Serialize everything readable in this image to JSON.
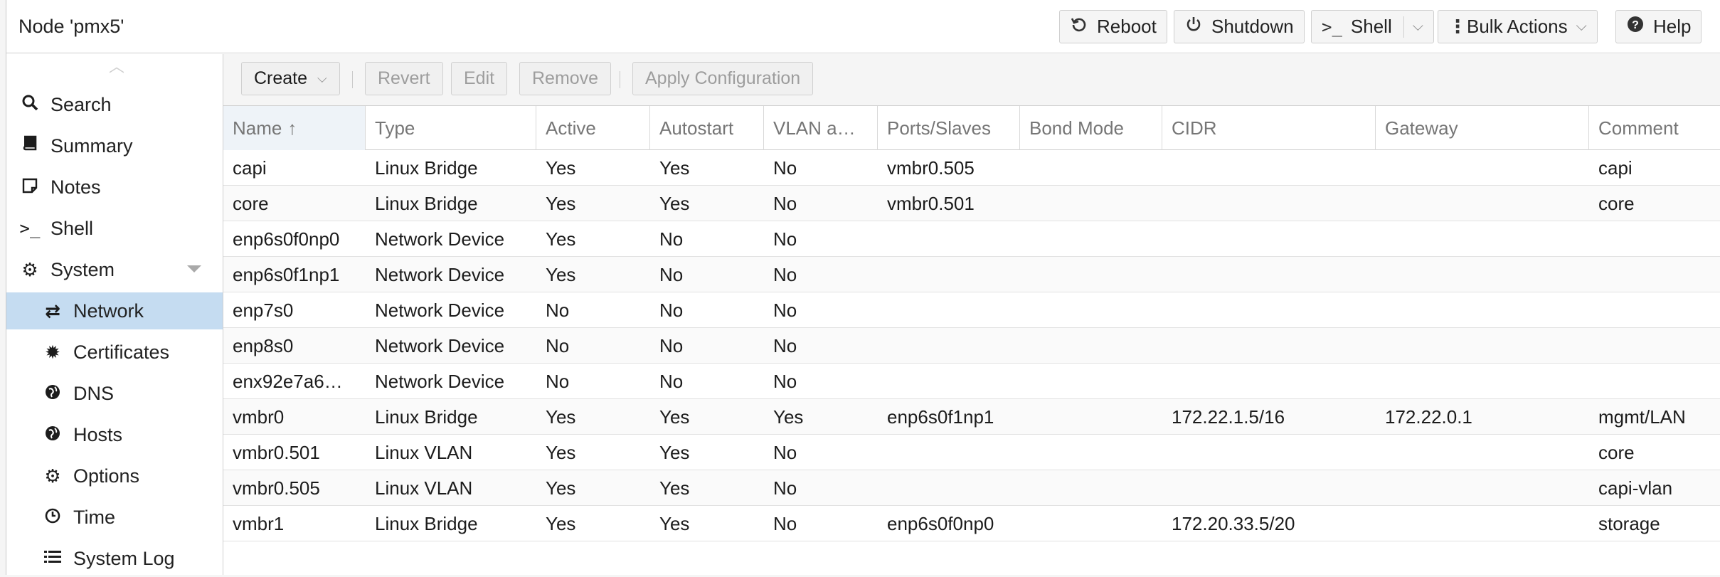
{
  "header": {
    "title": "Node 'pmx5'",
    "buttons": {
      "reboot": {
        "label": "Reboot",
        "icon": "undo-icon"
      },
      "shutdown": {
        "label": "Shutdown",
        "icon": "power-icon"
      },
      "shell": {
        "label": "Shell",
        "icon": "terminal-icon"
      },
      "bulk": {
        "label": "Bulk Actions",
        "icon": "kebab-icon"
      },
      "help": {
        "label": "Help",
        "icon": "question-circle-icon"
      }
    }
  },
  "sidebar": {
    "items": [
      {
        "label": "Search",
        "icon": "search-icon",
        "glyph": "🔍"
      },
      {
        "label": "Summary",
        "icon": "book-icon",
        "glyph": "📘"
      },
      {
        "label": "Notes",
        "icon": "note-icon",
        "glyph": "🗒"
      },
      {
        "label": "Shell",
        "icon": "terminal-icon",
        "glyph": ">_"
      },
      {
        "label": "System",
        "icon": "gears-icon",
        "glyph": "⚙"
      },
      {
        "label": "Network",
        "icon": "exchange-icon",
        "glyph": "⇄",
        "selected": true
      },
      {
        "label": "Certificates",
        "icon": "certificate-icon",
        "glyph": "✹"
      },
      {
        "label": "DNS",
        "icon": "globe-icon",
        "glyph": "🌐"
      },
      {
        "label": "Hosts",
        "icon": "globe-icon",
        "glyph": "🌐"
      },
      {
        "label": "Options",
        "icon": "gear-icon",
        "glyph": "⚙"
      },
      {
        "label": "Time",
        "icon": "clock-icon",
        "glyph": "🕓"
      },
      {
        "label": "System Log",
        "icon": "list-icon",
        "glyph": "☰"
      }
    ]
  },
  "toolbar": {
    "create": "Create",
    "revert": "Revert",
    "edit": "Edit",
    "remove": "Remove",
    "apply": "Apply Configuration"
  },
  "grid": {
    "columns": [
      "Name",
      "Type",
      "Active",
      "Autostart",
      "VLAN a…",
      "Ports/Slaves",
      "Bond Mode",
      "CIDR",
      "Gateway",
      "Comment"
    ],
    "sorted_column": "Name",
    "sort_direction": "ascending",
    "rows": [
      [
        "capi",
        "Linux Bridge",
        "Yes",
        "Yes",
        "No",
        "vmbr0.505",
        "",
        "",
        "",
        "capi"
      ],
      [
        "core",
        "Linux Bridge",
        "Yes",
        "Yes",
        "No",
        "vmbr0.501",
        "",
        "",
        "",
        "core"
      ],
      [
        "enp6s0f0np0",
        "Network Device",
        "Yes",
        "No",
        "No",
        "",
        "",
        "",
        "",
        ""
      ],
      [
        "enp6s0f1np1",
        "Network Device",
        "Yes",
        "No",
        "No",
        "",
        "",
        "",
        "",
        ""
      ],
      [
        "enp7s0",
        "Network Device",
        "No",
        "No",
        "No",
        "",
        "",
        "",
        "",
        ""
      ],
      [
        "enp8s0",
        "Network Device",
        "No",
        "No",
        "No",
        "",
        "",
        "",
        "",
        ""
      ],
      [
        "enx92e7a6…",
        "Network Device",
        "No",
        "No",
        "No",
        "",
        "",
        "",
        "",
        ""
      ],
      [
        "vmbr0",
        "Linux Bridge",
        "Yes",
        "Yes",
        "Yes",
        "enp6s0f1np1",
        "",
        "172.22.1.5/16",
        "172.22.0.1",
        "mgmt/LAN"
      ],
      [
        "vmbr0.501",
        "Linux VLAN",
        "Yes",
        "Yes",
        "No",
        "",
        "",
        "",
        "",
        "core"
      ],
      [
        "vmbr0.505",
        "Linux VLAN",
        "Yes",
        "Yes",
        "No",
        "",
        "",
        "",
        "",
        "capi-vlan"
      ],
      [
        "vmbr1",
        "Linux Bridge",
        "Yes",
        "Yes",
        "No",
        "enp6s0f0np0",
        "",
        "172.20.33.5/20",
        "",
        "storage"
      ]
    ]
  }
}
